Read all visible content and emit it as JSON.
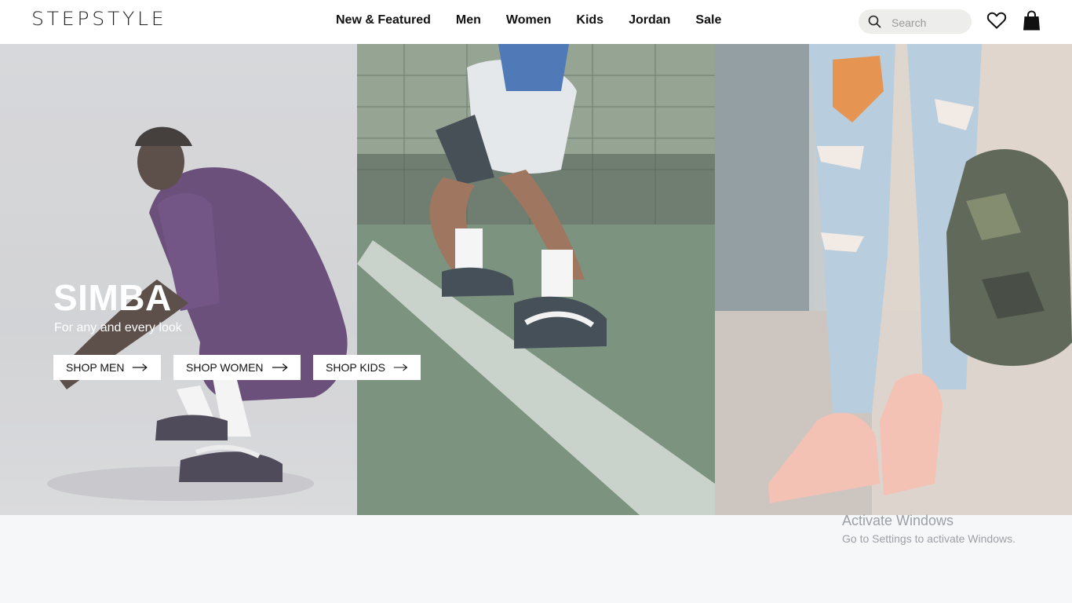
{
  "header": {
    "logo": "STEPSTYLE",
    "nav": [
      "New & Featured",
      "Men",
      "Women",
      "Kids",
      "Jordan",
      "Sale"
    ],
    "search": {
      "placeholder": "Search"
    },
    "icons": {
      "search": "search-icon",
      "favorites": "heart-icon",
      "bag": "shopping-bag-icon"
    }
  },
  "hero": {
    "title": "SIMBA",
    "subtitle": "For any and every look",
    "buttons": [
      "SHOP MEN",
      "SHOP WOMEN",
      "SHOP KIDS"
    ],
    "panels": [
      {
        "name": "man-crouching-purple-outfit-photo"
      },
      {
        "name": "tennis-court-sneakers-photo"
      },
      {
        "name": "ripped-jeans-pink-sneakers-photo"
      }
    ]
  },
  "watermark": {
    "line1": "Activate Windows",
    "line2": "Go to Settings to activate Windows."
  },
  "colors": {
    "header_bg": "#ffffff",
    "page_bg": "#f6f7f9",
    "button_bg": "#ffffff",
    "text": "#111111"
  }
}
